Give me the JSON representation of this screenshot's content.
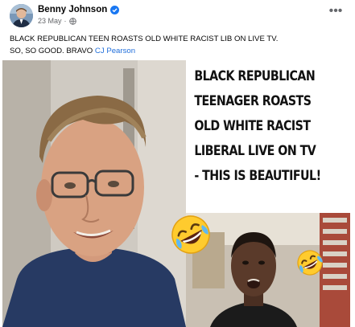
{
  "post": {
    "author": "Benny Johnson",
    "date": "23 May",
    "separator": "·",
    "text_line1": "BLACK REPUBLICAN TEEN ROASTS OLD WHITE RACIST LIB ON LIVE TV.",
    "text_line2": "SO, SO GOOD. BRAVO",
    "mention": "CJ Pearson",
    "more_label": "•••"
  },
  "media": {
    "headline": [
      "BLACK REPUBLICAN",
      "TEENAGER ROASTS",
      "OLD WHITE RACIST",
      "LIBERAL LIVE ON TV",
      "- THIS IS BEAUTIFUL!"
    ]
  },
  "colors": {
    "accent": "#1877f2",
    "mention": "#216fdb",
    "meta": "#65676b"
  }
}
